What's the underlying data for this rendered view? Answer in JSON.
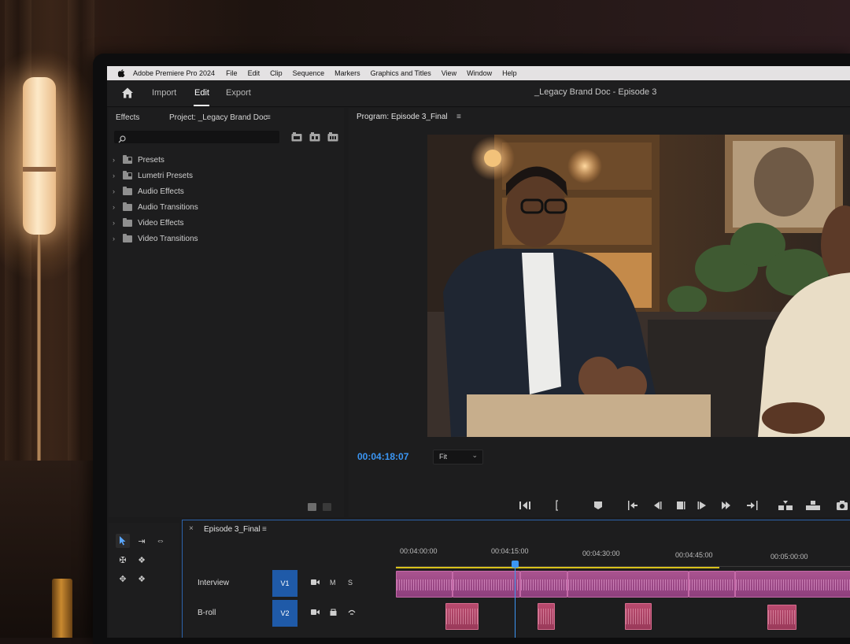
{
  "menubar": {
    "app_name": "Adobe Premiere Pro 2024",
    "items": [
      "File",
      "Edit",
      "Clip",
      "Sequence",
      "Markers",
      "Graphics and Titles",
      "View",
      "Window",
      "Help"
    ]
  },
  "header": {
    "tabs": [
      "Import",
      "Edit",
      "Export"
    ],
    "active_tab": "Edit",
    "document_title": "_Legacy Brand Doc - Episode 3"
  },
  "effects_panel": {
    "tab_effects": "Effects",
    "tab_project": "Project: _Legacy Brand Doc",
    "menu_glyph": "≡",
    "search_placeholder": "",
    "tree": [
      {
        "label": "Presets",
        "icon": "preset-folder-icon"
      },
      {
        "label": "Lumetri Presets",
        "icon": "preset-folder-icon"
      },
      {
        "label": "Audio Effects",
        "icon": "folder-icon"
      },
      {
        "label": "Audio Transitions",
        "icon": "folder-icon"
      },
      {
        "label": "Video Effects",
        "icon": "folder-icon"
      },
      {
        "label": "Video Transitions",
        "icon": "folder-icon"
      }
    ]
  },
  "program_monitor": {
    "title": "Program: Episode 3_Final",
    "menu_glyph": "≡",
    "timecode": "00:04:18:07",
    "zoom": "Fit"
  },
  "timeline": {
    "sequence_name": "Episode 3_Final",
    "menu_glyph": "≡",
    "close_glyph": "×",
    "ruler": [
      "00:04:00:00",
      "00:04:15:00",
      "00:04:30:00",
      "00:04:45:00",
      "00:05:00:00"
    ],
    "tracks": [
      {
        "name": "Interview",
        "target": "V1",
        "controls": [
          "M",
          "S"
        ]
      },
      {
        "name": "B-roll",
        "target": "V2",
        "controls": []
      }
    ]
  },
  "colors": {
    "accent_blue": "#3b96f4",
    "interview_clip": "#a9538f",
    "broll_clip": "#b94a6e",
    "work_area": "#d8c11b"
  }
}
